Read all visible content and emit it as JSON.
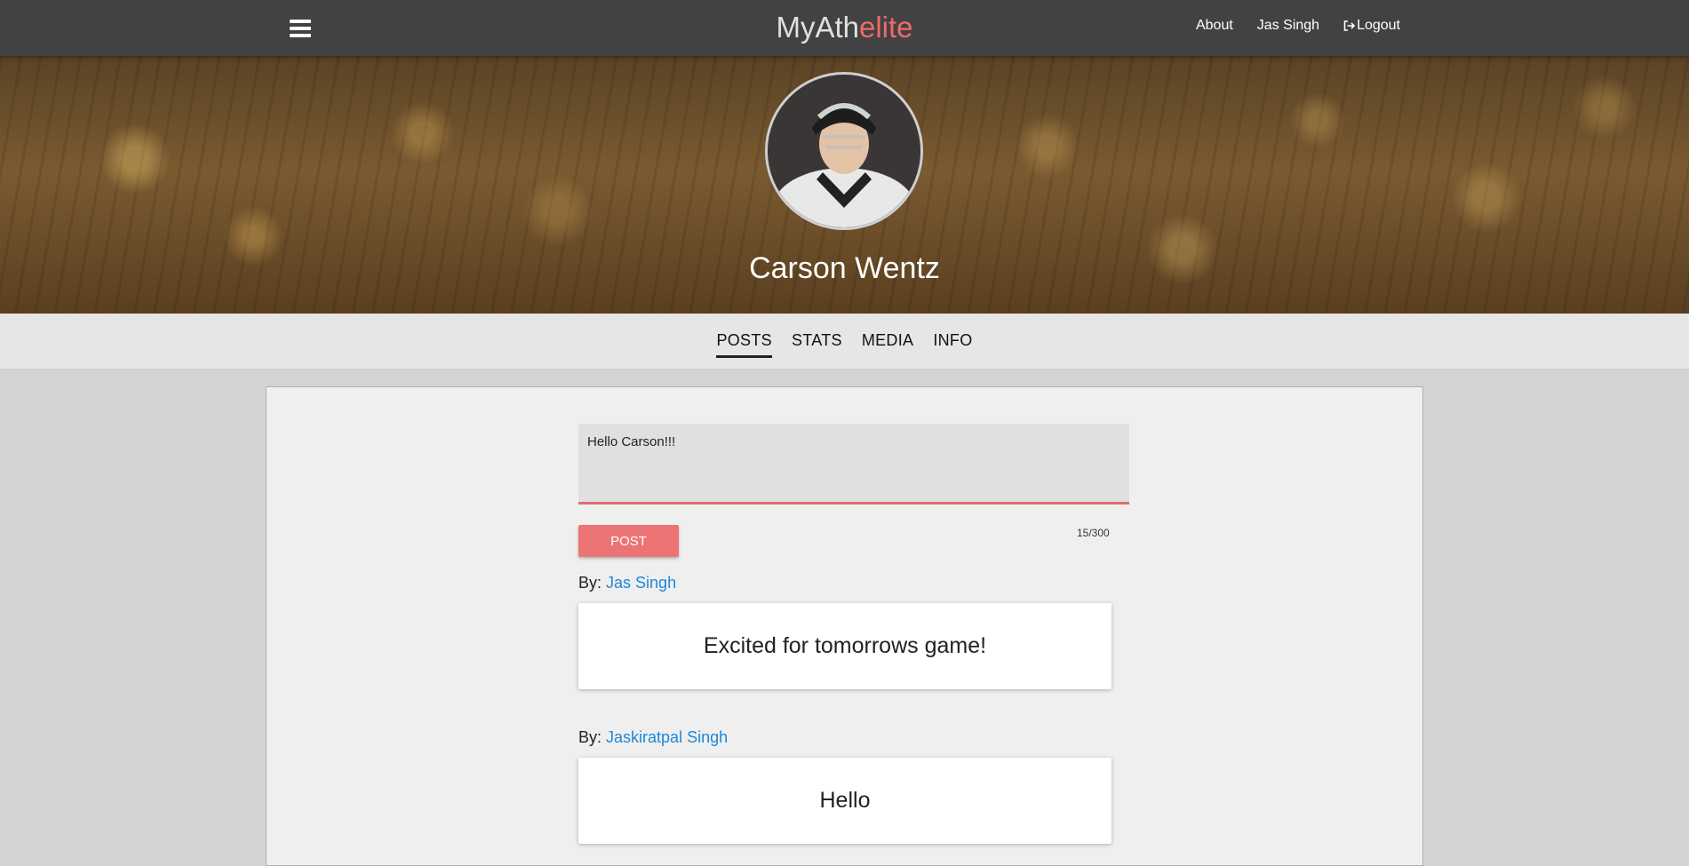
{
  "header": {
    "brand_prefix": "MyAth",
    "brand_accent": "elite",
    "links": {
      "about": "About",
      "user": "Jas Singh",
      "logout": "Logout"
    }
  },
  "profile": {
    "name": "Carson Wentz"
  },
  "tabs": [
    {
      "label": "POSTS",
      "active": true
    },
    {
      "label": "STATS",
      "active": false
    },
    {
      "label": "MEDIA",
      "active": false
    },
    {
      "label": "INFO",
      "active": false
    }
  ],
  "composer": {
    "value": "Hello Carson!!!",
    "post_label": "POST",
    "char_count": "15/300"
  },
  "posts": [
    {
      "by_label": "By:",
      "author": "Jas Singh",
      "text": "Excited for tomorrows game!"
    },
    {
      "by_label": "By:",
      "author": "Jaskiratpal Singh",
      "text": "Hello"
    }
  ],
  "colors": {
    "navbar": "#424242",
    "accent": "#ef6a6a",
    "link": "#1e88d8",
    "post_button": "#ec7474"
  }
}
